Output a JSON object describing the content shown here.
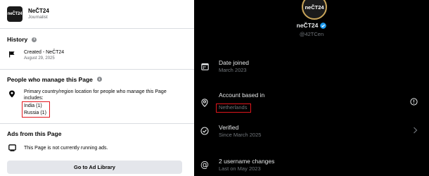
{
  "facebook": {
    "page_name": "NeČT24",
    "page_role": "Journalist",
    "avatar_text": "neČT24",
    "history": {
      "title": "History",
      "created_label": "Created - NeČT24",
      "created_date": "August 29, 2025"
    },
    "managers": {
      "title": "People who manage this Page",
      "description": "Primary country/region location for people who manage this Page includes:",
      "countries": [
        "India (1)",
        "Russia (1)"
      ]
    },
    "ads": {
      "title": "Ads from this Page",
      "status": "This Page is not currently running ads.",
      "button": "Go to Ad Library"
    }
  },
  "x": {
    "avatar_text": "neČT24",
    "display_name": "neČT24",
    "handle": "@42TCen",
    "accent_color": "#1d9bf0",
    "rows": [
      {
        "label": "Date joined",
        "value": "March 2023",
        "icon": "calendar-icon"
      },
      {
        "label": "Account based in",
        "value": "Netherlands",
        "icon": "location-icon"
      },
      {
        "label": "Verified",
        "value": "Since March 2025",
        "icon": "verified-check-icon"
      },
      {
        "label": "2 username changes",
        "value": "Last on May 2023",
        "icon": "at-sign-icon"
      }
    ]
  },
  "colors": {
    "highlight_box": "#e0161c",
    "fb_button_bg": "#e4e6eb",
    "x_background": "#000000",
    "x_secondary_text": "#71767b"
  }
}
